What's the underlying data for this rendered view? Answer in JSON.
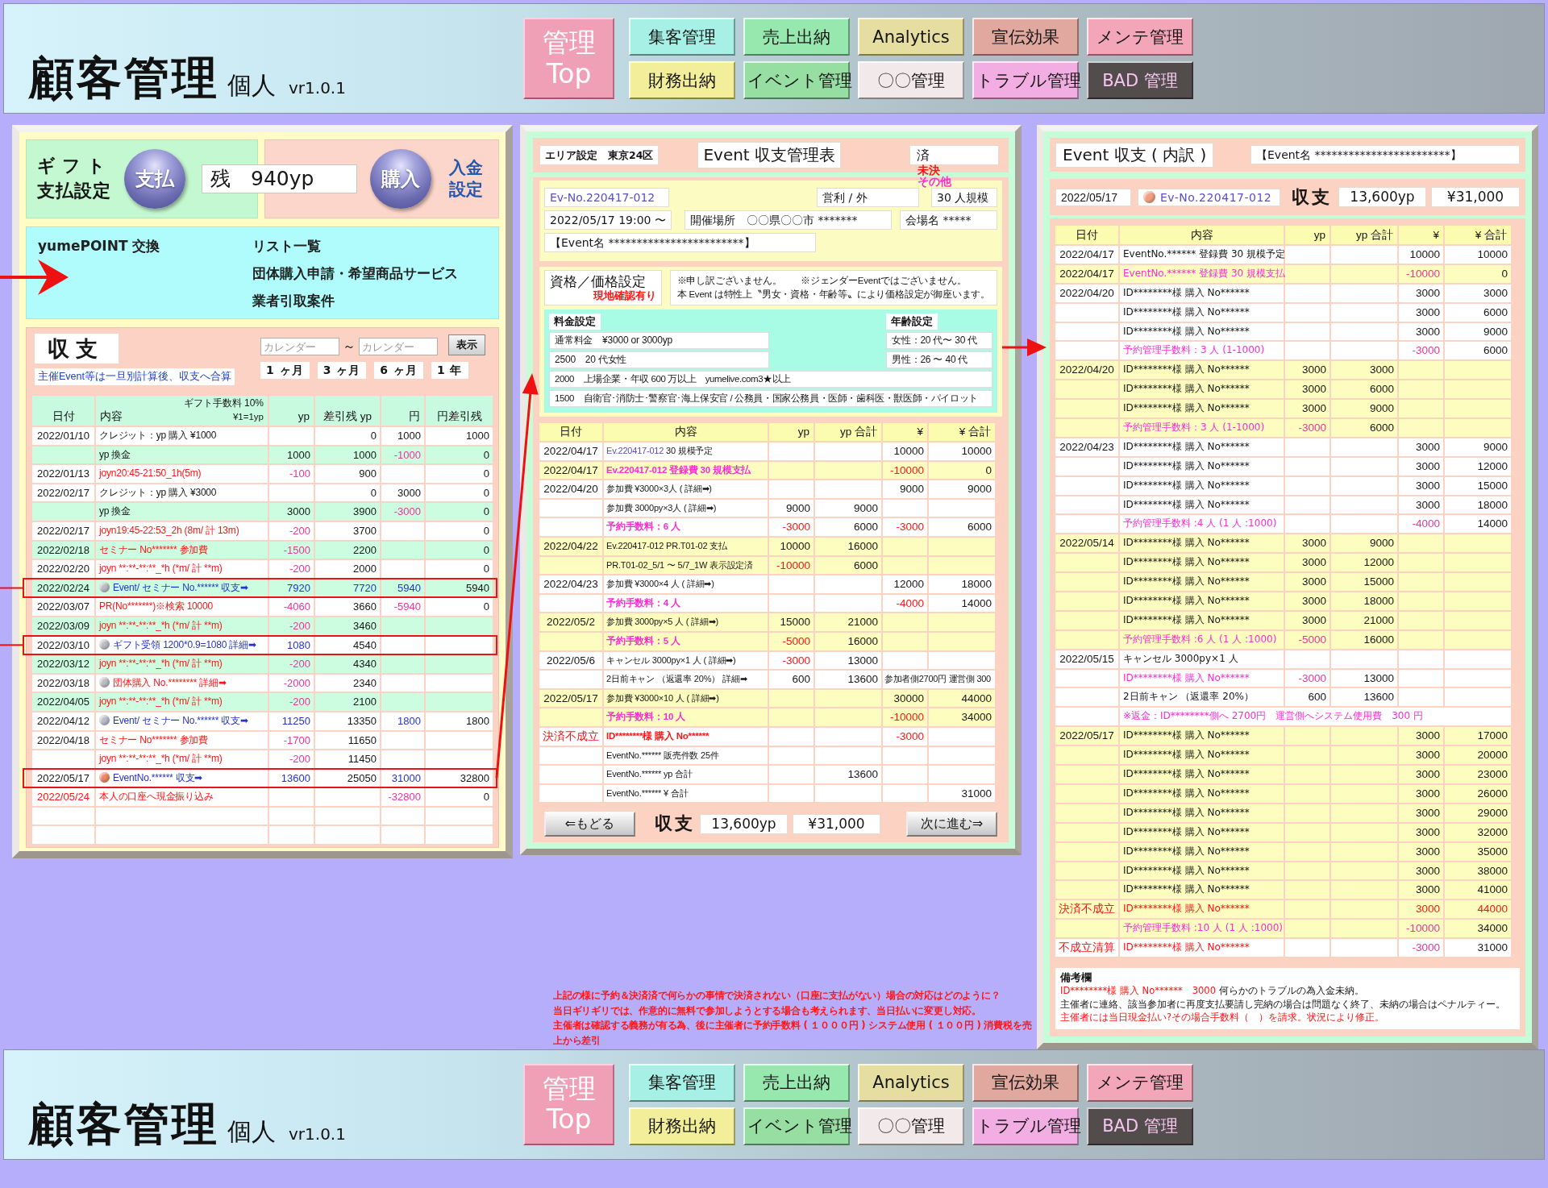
{
  "header": {
    "title": "顧客管理",
    "subtitle": "個人",
    "version": "vr1.0.1",
    "home": "管理 Top",
    "nav": [
      {
        "label": "集客管理",
        "color": "#a6f0e6"
      },
      {
        "label": "売上出納",
        "color": "#96e8ae"
      },
      {
        "label": "Analytics",
        "color": "#e6dea0"
      },
      {
        "label": "宣伝効果",
        "color": "#e0a89e"
      },
      {
        "label": "メンテ管理",
        "color": "#f2a6b8"
      },
      {
        "label": "財務出納",
        "color": "#f2ee9a"
      },
      {
        "label": "イベント管理",
        "color": "#96dea2"
      },
      {
        "label": "〇〇管理",
        "color": "#f2eaea"
      },
      {
        "label": "トラブル管理",
        "color": "#f2aee2"
      },
      {
        "label": "BAD 管理",
        "color": "#524c4c"
      }
    ]
  },
  "wallet": {
    "gift_title": "ギフト",
    "gift_subtitle": "支払設定",
    "pay_button": "支払",
    "balance": "残　940yp",
    "buy_button": "購入",
    "deposit_link": "入金設定",
    "menu": {
      "exchange": "yumePOINT 交換",
      "links": [
        "リスト一覧",
        "団体購入申請・希望商品サービス",
        "業者引取案件"
      ]
    },
    "ledger": {
      "title": "収支",
      "note": "主催Event等は一旦別計算後、収支へ合算",
      "date_from": {
        "placeholder": "カレンダー"
      },
      "range_sep": "～",
      "date_to": {
        "placeholder": "カレンダー"
      },
      "show_button": "表示",
      "periods": [
        "1 ヶ月",
        "3 ヶ月",
        "6 ヶ月",
        "1 年"
      ],
      "fee_note": "ギフト手数料 10%",
      "rate_note": "¥1=1yp",
      "columns": [
        "日付",
        "内容",
        "yp",
        "差引残 yp",
        "円",
        "円差引残"
      ],
      "rows": [
        {
          "color": "#ffffff",
          "highlighted": false,
          "cells": [
            {
              "text": "2022/01/10"
            },
            {
              "text": "クレジット：yp 購入 ¥1000"
            },
            null,
            {
              "text": "0"
            },
            {
              "text": "1000"
            },
            {
              "text": "1000"
            }
          ]
        },
        {
          "color": "#ccfde0",
          "highlighted": false,
          "cells": [
            null,
            {
              "text": "yp 換金"
            },
            {
              "text": "1000"
            },
            {
              "text": "1000"
            },
            {
              "text": "-1000",
              "color": "#e8369c"
            },
            {
              "text": "0"
            }
          ]
        },
        {
          "color": "#ffffff",
          "highlighted": false,
          "cells": [
            {
              "text": "2022/01/13"
            },
            {
              "text": "joyn20:45-21:50_1h(5m)",
              "color": "#ff1414"
            },
            {
              "text": "-100",
              "color": "#e8369c"
            },
            {
              "text": "900"
            },
            null,
            {
              "text": "0"
            }
          ]
        },
        {
          "color": "#ffffff",
          "highlighted": false,
          "cells": [
            {
              "text": "2022/02/17"
            },
            {
              "text": "クレジット：yp 購入 ¥3000"
            },
            null,
            {
              "text": "0"
            },
            {
              "text": "3000"
            },
            {
              "text": "0"
            }
          ]
        },
        {
          "color": "#ccfde0",
          "highlighted": false,
          "cells": [
            null,
            {
              "text": "yp 換金"
            },
            {
              "text": "3000"
            },
            {
              "text": "3900"
            },
            {
              "text": "-3000",
              "color": "#e8369c"
            },
            {
              "text": "0"
            }
          ]
        },
        {
          "color": "#ffffff",
          "highlighted": false,
          "cells": [
            {
              "text": "2022/02/17"
            },
            {
              "text": "joyn19:45-22:53_2h (8m/ 計 13m)",
              "color": "#ff1414"
            },
            {
              "text": "-200",
              "color": "#e8369c"
            },
            {
              "text": "3700"
            },
            null,
            {
              "text": "0"
            }
          ]
        },
        {
          "color": "#ccfde0",
          "highlighted": false,
          "cells": [
            {
              "text": "2022/02/18"
            },
            {
              "text": "セミナー No******* 参加費",
              "color": "#ff1414"
            },
            {
              "text": "-1500",
              "color": "#e8369c"
            },
            {
              "text": "2200"
            },
            null,
            {
              "text": "0"
            }
          ]
        },
        {
          "color": "#ffffff",
          "highlighted": false,
          "cells": [
            {
              "text": "2022/02/20"
            },
            {
              "text": "joyn **:**-**:**_*h (*m/ 計 **m)",
              "color": "#ff1414"
            },
            {
              "text": "-200",
              "color": "#e8369c"
            },
            {
              "text": "2000"
            },
            null,
            {
              "text": "0"
            }
          ]
        },
        {
          "color": "#ccfde0",
          "highlighted": true,
          "cells": [
            {
              "text": "2022/02/24"
            },
            {
              "text": "Event/ セミナー No.****** 収支➡",
              "color": "#2434c8",
              "marker": {
                "color": "#bcbcc4"
              }
            },
            {
              "text": "7920",
              "color": "#2434c8"
            },
            {
              "text": "7720",
              "color": "#2434c8"
            },
            {
              "text": "5940",
              "color": "#2434c8"
            },
            {
              "text": "5940"
            }
          ]
        },
        {
          "color": "#ffffff",
          "highlighted": false,
          "cells": [
            {
              "text": "2022/03/07"
            },
            {
              "text": "PR(No*******)※検索 10000",
              "color": "#ff1414"
            },
            {
              "text": "-4060",
              "color": "#e8369c"
            },
            {
              "text": "3660"
            },
            {
              "text": "-5940",
              "color": "#e8369c"
            },
            {
              "text": "0"
            }
          ]
        },
        {
          "color": "#ccfde0",
          "highlighted": false,
          "cells": [
            {
              "text": "2022/03/09"
            },
            {
              "text": "joyn **:**-**:**_*h (*m/ 計 **m)",
              "color": "#ff1414"
            },
            {
              "text": "-200",
              "color": "#e8369c"
            },
            {
              "text": "3460"
            },
            null,
            null
          ]
        },
        {
          "color": "#ffffff",
          "highlighted": true,
          "cells": [
            {
              "text": "2022/03/10"
            },
            {
              "text": "ギフト受領 1200*0.9=1080 詳細➡",
              "color": "#2434c8",
              "marker": {
                "color": "#bcbcc4"
              }
            },
            {
              "text": "1080",
              "color": "#2434c8"
            },
            {
              "text": "4540"
            },
            null,
            null
          ]
        },
        {
          "color": "#ccfde0",
          "highlighted": false,
          "cells": [
            {
              "text": "2022/03/12"
            },
            {
              "text": "joyn **:**-**:**_*h (*m/ 計 **m)",
              "color": "#ff1414"
            },
            {
              "text": "-200",
              "color": "#e8369c"
            },
            {
              "text": "4340"
            },
            null,
            null
          ]
        },
        {
          "color": "#ffffff",
          "highlighted": false,
          "cells": [
            {
              "text": "2022/03/18"
            },
            {
              "text": "団体購入 No.******** 詳細➡",
              "color": "#ff1414",
              "marker": {
                "color": "#bcbcc4"
              }
            },
            {
              "text": "-2000",
              "color": "#e8369c"
            },
            {
              "text": "2340"
            },
            null,
            null
          ]
        },
        {
          "color": "#ccfde0",
          "highlighted": false,
          "cells": [
            {
              "text": "2022/04/05"
            },
            {
              "text": "joyn **:**-**:**_*h (*m/ 計 **m)",
              "color": "#ff1414"
            },
            {
              "text": "-200",
              "color": "#e8369c"
            },
            {
              "text": "2100"
            },
            null,
            null
          ]
        },
        {
          "color": "#ffffff",
          "highlighted": false,
          "cells": [
            {
              "text": "2022/04/12"
            },
            {
              "text": "Event/ セミナー No.****** 収支➡",
              "color": "#2434c8",
              "marker": {
                "color": "#bcbcc4"
              }
            },
            {
              "text": "11250",
              "color": "#2434c8"
            },
            {
              "text": "13350"
            },
            {
              "text": "1800",
              "color": "#2434c8"
            },
            {
              "text": "1800"
            }
          ]
        },
        {
          "color": "#ffffff",
          "highlighted": false,
          "cells": [
            {
              "text": "2022/04/18"
            },
            {
              "text": "セミナー No******* 参加費",
              "color": "#ff1414"
            },
            {
              "text": "-1700",
              "color": "#e8369c"
            },
            {
              "text": "11650"
            },
            null,
            null
          ]
        },
        {
          "color": "#ffffff",
          "highlighted": false,
          "cells": [
            null,
            {
              "text": "joyn **:**-**:**_*h (*m/ 計 **m)",
              "color": "#ff1414"
            },
            {
              "text": "-200",
              "color": "#e8369c"
            },
            {
              "text": "11450"
            },
            null,
            null
          ]
        },
        {
          "color": "#ffffff",
          "highlighted": true,
          "cells": [
            {
              "text": "2022/05/17"
            },
            {
              "text": "EventNo.****** 収支➡",
              "color": "#2434c8",
              "marker": {
                "color": "#f0866a"
              }
            },
            {
              "text": "13600",
              "color": "#2434c8"
            },
            {
              "text": "25050"
            },
            {
              "text": "31000",
              "color": "#2434c8"
            },
            {
              "text": "32800"
            }
          ]
        },
        {
          "color": "#ffffff",
          "highlighted": false,
          "cells": [
            {
              "text": "2022/05/24",
              "color": "#ff1414"
            },
            {
              "text": "本人の口座へ現金振り込み",
              "color": "#ff1414"
            },
            null,
            null,
            {
              "text": "-32800",
              "color": "#e8369c"
            },
            {
              "text": "0"
            }
          ]
        },
        {
          "color": "#ffffff",
          "highlighted": false,
          "cells": [
            null,
            null,
            null,
            null,
            null,
            null
          ]
        },
        {
          "color": "#ffffff",
          "highlighted": false,
          "cells": [
            null,
            null,
            null,
            null,
            null,
            null
          ]
        }
      ]
    }
  },
  "event_sheet": {
    "area": "エリア設定　東京24区",
    "title": "Event 収支管理表",
    "status": {
      "value": "済",
      "options": [
        {
          "label": "未決",
          "color": "#ff1414"
        },
        {
          "label": "その他",
          "color": "#ff2ad2"
        }
      ]
    },
    "event_no": "Ev-No.220417-012",
    "business_type": "営利 / 外",
    "scale": "30 人規模",
    "datetime": "2022/05/17 19:00 〜",
    "venue": "開催場所　〇〇県〇〇市 *******",
    "hall": "会場名 *****",
    "event_name": "【Event名 ************************】",
    "pricing": {
      "title": "資格／価格設定",
      "subtitle": "現地確認有り",
      "notes": [
        "※申し訳ございません。　　※ジェンダーEventではございません。",
        "本 Event は特性上〝男女・資格・年齢等〟により価格設定が御座います。"
      ],
      "fee_label": "料金設定",
      "age_label": "年齢設定",
      "fees": [
        "通常料金　¥3000 or 3000yp",
        "2500　20 代女性",
        "2000　上場企業・年収 600 万以上　yumelive.com3★以上",
        "1500　自衛官･消防士･警察官･海上保安官 / 公務員・国家公務員・医師・歯科医・獣医師・パイロット"
      ],
      "ages": [
        "女性：20 代〜 30 代",
        "男性：26 〜 40 代"
      ]
    },
    "table": {
      "columns": [
        "日付",
        "内容",
        "yp",
        "yp 合計",
        "¥",
        "¥ 合計"
      ],
      "rows": [
        {
          "color": "#ffffff",
          "cells": [
            {
              "text": "2022/04/17"
            },
            {
              "parts": [
                {
                  "text": "Ev.220417-012",
                  "color": "#5a4fc4"
                },
                {
                  "text": " 30 規模予定"
                }
              ]
            },
            null,
            null,
            {
              "text": "10000"
            },
            {
              "text": "10000"
            }
          ]
        },
        {
          "color": "#fdfdc0",
          "cells": [
            {
              "text": "2022/04/17"
            },
            {
              "text": "Ev.220417-012 登録費 30 規模支払",
              "color": "#ff2ad2"
            },
            null,
            null,
            {
              "text": "-10000",
              "color": "#ff1414"
            },
            {
              "text": "0"
            }
          ]
        },
        {
          "color": "#ffffff",
          "cells": [
            {
              "text": "2022/04/20"
            },
            {
              "text": "参加費 ¥3000×3人 ( 詳細➡)"
            },
            null,
            null,
            {
              "text": "9000"
            },
            {
              "text": "9000"
            }
          ]
        },
        {
          "color": "#ffffff",
          "cells": [
            null,
            {
              "text": "参加費 3000py×3人 ( 詳細➡)"
            },
            {
              "text": "9000"
            },
            {
              "text": "9000"
            },
            null,
            null
          ]
        },
        {
          "color": "#ffffff",
          "cells": [
            null,
            {
              "text": "予約手数料：6 人",
              "color": "#ff2ad2"
            },
            {
              "text": "-3000",
              "color": "#ff1414"
            },
            {
              "text": "6000"
            },
            {
              "text": "-3000",
              "color": "#ff1414"
            },
            {
              "text": "6000"
            }
          ]
        },
        {
          "color": "#fdfdc0",
          "cells": [
            {
              "text": "2022/04/22"
            },
            {
              "text": "Ev.220417-012 PR.T01-02 支払"
            },
            {
              "text": "10000"
            },
            {
              "text": "16000"
            },
            null,
            null
          ]
        },
        {
          "color": "#fdfdc0",
          "cells": [
            null,
            {
              "text": "PR.T01-02_5/1 〜 5/7_1W 表示設定済"
            },
            {
              "text": "-10000",
              "color": "#ff1414"
            },
            {
              "text": "6000"
            },
            null,
            null
          ]
        },
        {
          "color": "#ffffff",
          "cells": [
            {
              "text": "2022/04/23"
            },
            {
              "text": "参加費 ¥3000×4 人 ( 詳細➡)"
            },
            null,
            null,
            {
              "text": "12000"
            },
            {
              "text": "18000"
            }
          ]
        },
        {
          "color": "#ffffff",
          "cells": [
            null,
            {
              "text": "予約手数料：4 人",
              "color": "#ff2ad2"
            },
            null,
            null,
            {
              "text": "-4000",
              "color": "#ff1414"
            },
            {
              "text": "14000"
            }
          ]
        },
        {
          "color": "#fdfdc0",
          "cells": [
            {
              "text": "2022/05/2"
            },
            {
              "text": "参加費 3000py×5 人 ( 詳細➡)"
            },
            {
              "text": "15000"
            },
            {
              "text": "21000"
            },
            null,
            null
          ]
        },
        {
          "color": "#fdfdc0",
          "cells": [
            null,
            {
              "text": "予約手数料：5 人",
              "color": "#ff2ad2"
            },
            {
              "text": "-5000",
              "color": "#ff1414"
            },
            {
              "text": "16000"
            },
            null,
            null
          ]
        },
        {
          "color": "#ffffff",
          "cells": [
            {
              "text": "2022/05/6"
            },
            {
              "text": "キャンセル 3000py×1 人 ( 詳細➡)"
            },
            {
              "text": "-3000",
              "color": "#ff1414"
            },
            {
              "text": "13000"
            },
            null,
            null
          ]
        },
        {
          "color": "#ffffff",
          "cells": [
            null,
            {
              "text": "2日前キャン （返還率 20%） 詳細➡"
            },
            {
              "text": "600"
            },
            {
              "text": "13600"
            }
          ],
          "note": {
            "text": "参加者側2700円 運営側 300"
          }
        },
        {
          "color": "#fdfdc0",
          "cells": [
            {
              "text": "2022/05/17"
            },
            {
              "text": "参加費 ¥3000×10 人 ( 詳細➡)"
            },
            null,
            null,
            {
              "text": "30000"
            },
            {
              "text": "44000"
            }
          ]
        },
        {
          "color": "#fdfdc0",
          "cells": [
            null,
            {
              "text": "予約手数料：10 人",
              "color": "#ff2ad2"
            },
            null,
            null,
            {
              "text": "-10000",
              "color": "#ff1414"
            },
            {
              "text": "34000"
            }
          ]
        },
        {
          "color": "#ffffff",
          "cells": [
            {
              "text": "決済不成立",
              "color": "#ff1414"
            },
            {
              "text": "ID********様 購入 No******",
              "color": "#ff1414"
            },
            null,
            null,
            {
              "text": "-3000",
              "color": "#ff1414"
            },
            null
          ]
        },
        {
          "color": "#ffffff",
          "cells": [
            null,
            {
              "text": "EventNo.****** 販売件数 25件"
            },
            null,
            null,
            null,
            null
          ]
        },
        {
          "color": "#ffffff",
          "cells": [
            null,
            {
              "text": "EventNo.****** yp 合計"
            },
            null,
            {
              "text": "13600"
            },
            null,
            null
          ]
        },
        {
          "color": "#ffffff",
          "cells": [
            null,
            {
              "text": "EventNo.****** ¥ 合計"
            },
            null,
            null,
            null,
            {
              "text": "31000"
            }
          ]
        }
      ]
    },
    "back_button": "⇐もどる",
    "total_label": "収支",
    "total_yp": "13,600yp",
    "total_yen": "¥31,000",
    "next_button": "次に進む⇒"
  },
  "breakdown": {
    "title": "Event 収支 ( 内訳 )",
    "event_name": "【Event名 ************************】",
    "date": "2022/05/17",
    "event_no": {
      "text": "Ev-No.220417-012",
      "marker": {
        "color": "#f0a080"
      }
    },
    "total_label": "収支",
    "total_yp": "13,600yp",
    "total_yen": "¥31,000",
    "table": {
      "columns": [
        "日付",
        "内容",
        "yp",
        "yp 合計",
        "¥",
        "¥ 合計"
      ],
      "rows": [
        {
          "color": "#ffffff",
          "cells": [
            {
              "text": "2022/04/17"
            },
            {
              "text": "EventNo.****** 登録費 30 規模予定"
            },
            null,
            null,
            {
              "text": "10000"
            },
            {
              "text": "10000"
            }
          ]
        },
        {
          "color": "#fdfdc0",
          "cells": [
            {
              "text": "2022/04/17"
            },
            {
              "text": "EventNo.****** 登録費 30 規模支払",
              "color": "#ff2ad2"
            },
            null,
            null,
            {
              "text": "-10000",
              "color": "#e8369c"
            },
            {
              "text": "0"
            }
          ]
        },
        {
          "color": "#ffffff",
          "cells": [
            {
              "text": "2022/04/20"
            },
            {
              "text": "ID********様 購入 No******"
            },
            null,
            null,
            {
              "text": "3000"
            },
            {
              "text": "3000"
            }
          ]
        },
        {
          "color": "#ffffff",
          "cells": [
            null,
            {
              "text": "ID********様 購入 No******"
            },
            null,
            null,
            {
              "text": "3000"
            },
            {
              "text": "6000"
            }
          ]
        },
        {
          "color": "#ffffff",
          "cells": [
            null,
            {
              "text": "ID********様 購入 No******"
            },
            null,
            null,
            {
              "text": "3000"
            },
            {
              "text": "9000"
            }
          ]
        },
        {
          "color": "#ffffff",
          "cells": [
            null,
            {
              "text": "予約管理手数料：3 人 (1-1000)",
              "color": "#ff2ad2"
            },
            null,
            null,
            {
              "text": "-3000",
              "color": "#e8369c"
            },
            {
              "text": "6000"
            }
          ]
        },
        {
          "color": "#fdfdc0",
          "cells": [
            {
              "text": "2022/04/20"
            },
            {
              "text": "ID********様 購入 No******"
            },
            {
              "text": "3000"
            },
            {
              "text": "3000"
            },
            null,
            null
          ]
        },
        {
          "color": "#fdfdc0",
          "cells": [
            null,
            {
              "text": "ID********様 購入 No******"
            },
            {
              "text": "3000"
            },
            {
              "text": "6000"
            },
            null,
            null
          ]
        },
        {
          "color": "#fdfdc0",
          "cells": [
            null,
            {
              "text": "ID********様 購入 No******"
            },
            {
              "text": "3000"
            },
            {
              "text": "9000"
            },
            null,
            null
          ]
        },
        {
          "color": "#fdfdc0",
          "cells": [
            null,
            {
              "text": "予約管理手数料：3 人 (1-1000)",
              "color": "#ff2ad2"
            },
            {
              "text": "-3000",
              "color": "#e8369c"
            },
            {
              "text": "6000"
            },
            null,
            null
          ]
        },
        {
          "color": "#ffffff",
          "cells": [
            {
              "text": "2022/04/23"
            },
            {
              "text": "ID********様 購入 No******"
            },
            null,
            null,
            {
              "text": "3000"
            },
            {
              "text": "9000"
            }
          ]
        },
        {
          "color": "#ffffff",
          "cells": [
            null,
            {
              "text": "ID********様 購入 No******"
            },
            null,
            null,
            {
              "text": "3000"
            },
            {
              "text": "12000"
            }
          ]
        },
        {
          "color": "#ffffff",
          "cells": [
            null,
            {
              "text": "ID********様 購入 No******"
            },
            null,
            null,
            {
              "text": "3000"
            },
            {
              "text": "15000"
            }
          ]
        },
        {
          "color": "#ffffff",
          "cells": [
            null,
            {
              "text": "ID********様 購入 No******"
            },
            null,
            null,
            {
              "text": "3000"
            },
            {
              "text": "18000"
            }
          ]
        },
        {
          "color": "#ffffff",
          "cells": [
            null,
            {
              "text": "予約管理手数料 :4 人 (1 人 :1000)",
              "color": "#ff2ad2"
            },
            null,
            null,
            {
              "text": "-4000",
              "color": "#e8369c"
            },
            {
              "text": "14000"
            }
          ]
        },
        {
          "color": "#fdfdc0",
          "cells": [
            {
              "text": "2022/05/14"
            },
            {
              "text": "ID********様 購入 No******"
            },
            {
              "text": "3000"
            },
            {
              "text": "9000"
            },
            null,
            null
          ]
        },
        {
          "color": "#fdfdc0",
          "cells": [
            null,
            {
              "text": "ID********様 購入 No******"
            },
            {
              "text": "3000"
            },
            {
              "text": "12000"
            },
            null,
            null
          ]
        },
        {
          "color": "#fdfdc0",
          "cells": [
            null,
            {
              "text": "ID********様 購入 No******"
            },
            {
              "text": "3000"
            },
            {
              "text": "15000"
            },
            null,
            null
          ]
        },
        {
          "color": "#fdfdc0",
          "cells": [
            null,
            {
              "text": "ID********様 購入 No******"
            },
            {
              "text": "3000"
            },
            {
              "text": "18000"
            },
            null,
            null
          ]
        },
        {
          "color": "#fdfdc0",
          "cells": [
            null,
            {
              "text": "ID********様 購入 No******"
            },
            {
              "text": "3000"
            },
            {
              "text": "21000"
            },
            null,
            null
          ]
        },
        {
          "color": "#fdfdc0",
          "cells": [
            null,
            {
              "text": "予約管理手数料 :6 人 (1 人 :1000)",
              "color": "#ff2ad2"
            },
            {
              "text": "-5000",
              "color": "#e8369c"
            },
            {
              "text": "16000"
            },
            null,
            null
          ]
        },
        {
          "color": "#ffffff",
          "cells": [
            {
              "text": "2022/05/15"
            },
            {
              "text": "キャンセル 3000py×1 人"
            },
            null,
            null,
            null,
            null
          ]
        },
        {
          "color": "#ffffff",
          "cells": [
            null,
            {
              "text": "ID********様 購入 No******",
              "color": "#ff2ad2"
            },
            {
              "text": "-3000",
              "color": "#e8369c"
            },
            {
              "text": "13000"
            },
            null,
            null
          ]
        },
        {
          "color": "#ffffff",
          "cells": [
            null,
            {
              "text": "2日前キャン （返還率 20%）"
            },
            {
              "text": "600"
            },
            {
              "text": "13600"
            },
            null,
            null
          ]
        },
        {
          "color": "#ffffff",
          "cells": [
            null
          ],
          "note": {
            "text": "※返金：ID********側へ 2700円　運営側へシステム使用費　300 円",
            "color": "#ff2ad2"
          }
        },
        {
          "color": "#fdfdc0",
          "cells": [
            {
              "text": "2022/05/17"
            },
            {
              "text": "ID********様 購入 No******"
            },
            null,
            null,
            {
              "text": "3000"
            },
            {
              "text": "17000"
            }
          ]
        },
        {
          "color": "#fdfdc0",
          "cells": [
            null,
            {
              "text": "ID********様 購入 No******"
            },
            null,
            null,
            {
              "text": "3000"
            },
            {
              "text": "20000"
            }
          ]
        },
        {
          "color": "#fdfdc0",
          "cells": [
            null,
            {
              "text": "ID********様 購入 No******"
            },
            null,
            null,
            {
              "text": "3000"
            },
            {
              "text": "23000"
            }
          ]
        },
        {
          "color": "#fdfdc0",
          "cells": [
            null,
            {
              "text": "ID********様 購入 No******"
            },
            null,
            null,
            {
              "text": "3000"
            },
            {
              "text": "26000"
            }
          ]
        },
        {
          "color": "#fdfdc0",
          "cells": [
            null,
            {
              "text": "ID********様 購入 No******"
            },
            null,
            null,
            {
              "text": "3000"
            },
            {
              "text": "29000"
            }
          ]
        },
        {
          "color": "#fdfdc0",
          "cells": [
            null,
            {
              "text": "ID********様 購入 No******"
            },
            null,
            null,
            {
              "text": "3000"
            },
            {
              "text": "32000"
            }
          ]
        },
        {
          "color": "#fdfdc0",
          "cells": [
            null,
            {
              "text": "ID********様 購入 No******"
            },
            null,
            null,
            {
              "text": "3000"
            },
            {
              "text": "35000"
            }
          ]
        },
        {
          "color": "#fdfdc0",
          "cells": [
            null,
            {
              "text": "ID********様 購入 No******"
            },
            null,
            null,
            {
              "text": "3000"
            },
            {
              "text": "38000"
            }
          ]
        },
        {
          "color": "#fdfdc0",
          "cells": [
            null,
            {
              "text": "ID********様 購入 No******"
            },
            null,
            null,
            {
              "text": "3000"
            },
            {
              "text": "41000"
            }
          ]
        },
        {
          "color": "#fdfdc0",
          "cells": [
            {
              "text": "決済不成立",
              "color": "#ff1414"
            },
            {
              "text": "ID********様 購入 No******",
              "color": "#ff1414"
            },
            null,
            null,
            {
              "text": "3000",
              "color": "#ff1414"
            },
            {
              "text": "44000",
              "color": "#ff1414"
            }
          ]
        },
        {
          "color": "#fdfdc0",
          "cells": [
            null,
            {
              "text": "予約管理手数料 :10 人 (1 人 :1000)",
              "color": "#ff2ad2"
            },
            null,
            null,
            {
              "text": "-10000",
              "color": "#e8369c"
            },
            {
              "text": "34000"
            }
          ]
        },
        {
          "color": "#ffffff",
          "cells": [
            {
              "text": "不成立清算",
              "color": "#ff1414"
            },
            {
              "text": "ID********様 購入 No******",
              "color": "#ff1414"
            },
            null,
            null,
            {
              "text": "-3000",
              "color": "#e8369c"
            },
            {
              "text": "31000"
            }
          ]
        }
      ]
    },
    "remarks": {
      "title": "備考欄",
      "lines": [
        {
          "parts": [
            {
              "text": "ID********様 購入 No******　3000",
              "color": "#ff1414"
            },
            {
              "text": " 何らかのトラブルの為入金未納。"
            }
          ]
        },
        {
          "text": "主催者に連絡、該当参加者に再度支払要請し完納の場合は問題なく終了、未納の場合はペナルティー。"
        },
        {
          "text": "主催者には当日現金払い?その場合手数料（　）を請求。状況により修正。",
          "color": "#ff1414"
        }
      ]
    }
  },
  "memo": [
    "上記の様に予約＆決済済で何らかの事情で決済されない（口座に支払がない）場合の対応はどのように？",
    "当日ギリギリでは、作意的に無料で参加しようとする場合も考えられます、当日払いに変更し対応。",
    "主催者は確認する義務が有る為、後に主催者に予約手数料 ( １０００円 ) システム使用 ( １００円 ) 消費税を売上から差引"
  ],
  "footer": {
    "title": "顧客管理",
    "subtitle": "個人",
    "version": "vr1.0.1",
    "home": "管理 Top",
    "nav": [
      {
        "label": "集客管理",
        "color": "#a6f0e6"
      },
      {
        "label": "売上出納",
        "color": "#96e8ae"
      },
      {
        "label": "Analytics",
        "color": "#e6dea0"
      },
      {
        "label": "宣伝効果",
        "color": "#e0a89e"
      },
      {
        "label": "メンテ管理",
        "color": "#f2a6b8"
      },
      {
        "label": "財務出納",
        "color": "#f2ee9a"
      },
      {
        "label": "イベント管理",
        "color": "#96dea2"
      },
      {
        "label": "〇〇管理",
        "color": "#f2eaea"
      },
      {
        "label": "トラブル管理",
        "color": "#f2aee2"
      },
      {
        "label": "BAD 管理",
        "color": "#524c4c"
      }
    ]
  }
}
